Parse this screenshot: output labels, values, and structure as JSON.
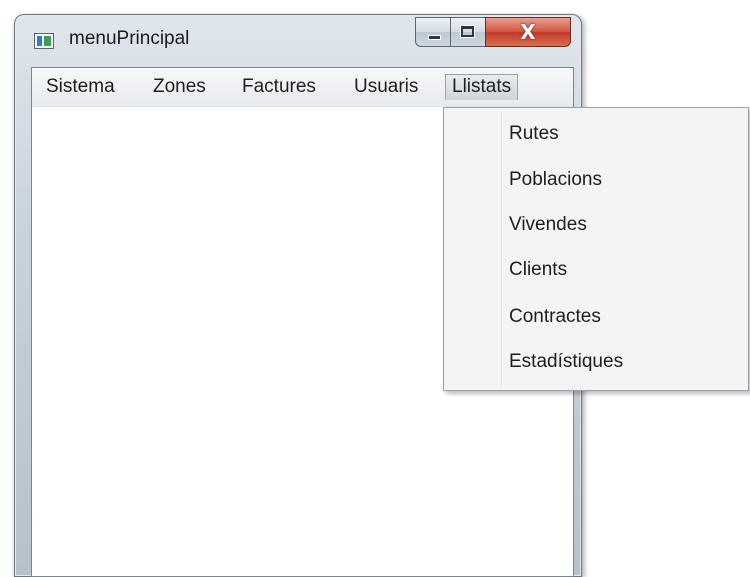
{
  "window": {
    "title": "menuPrincipal"
  },
  "caption": {
    "close_glyph": "X"
  },
  "menubar": {
    "items": [
      {
        "label": "Sistema"
      },
      {
        "label": "Zones"
      },
      {
        "label": "Factures"
      },
      {
        "label": "Usuaris"
      },
      {
        "label": "Llistats"
      }
    ],
    "active": "Llistats"
  },
  "dropdown": {
    "items": [
      {
        "label": "Rutes"
      },
      {
        "label": "Poblacions"
      },
      {
        "label": "Vivendes"
      },
      {
        "label": "Clients"
      },
      {
        "label": "Contractes"
      },
      {
        "label": "Estadístiques"
      }
    ]
  },
  "colors": {
    "close_button": "#c0392b",
    "menu_highlight": "#cfd5db",
    "window_frame": "#c8d2db"
  }
}
